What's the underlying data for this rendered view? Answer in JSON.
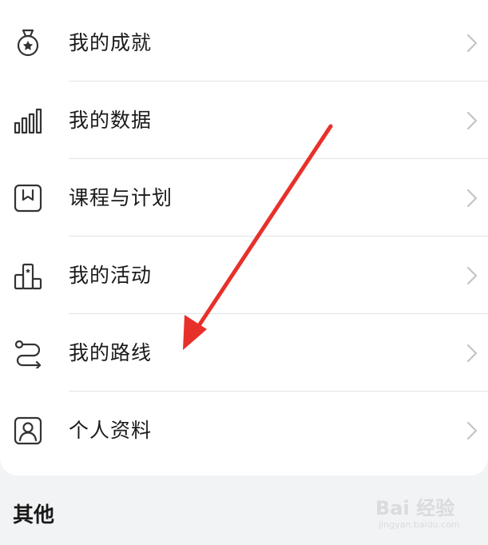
{
  "menu": {
    "items": [
      {
        "icon": "medal-icon",
        "label": "我的成就"
      },
      {
        "icon": "bar-chart-icon",
        "label": "我的数据"
      },
      {
        "icon": "bookmark-icon",
        "label": "课程与计划"
      },
      {
        "icon": "podium-icon",
        "label": "我的活动"
      },
      {
        "icon": "route-icon",
        "label": "我的路线"
      },
      {
        "icon": "profile-icon",
        "label": "个人资料"
      }
    ]
  },
  "section": {
    "other_title": "其他"
  },
  "watermark": {
    "brand": "Bai 经验",
    "sub": "jingyan.baidu.com"
  },
  "colors": {
    "annotation_arrow": "#e8302a",
    "icon_stroke": "#333333",
    "chevron": "#c4c4c6",
    "background": "#f2f3f5"
  }
}
